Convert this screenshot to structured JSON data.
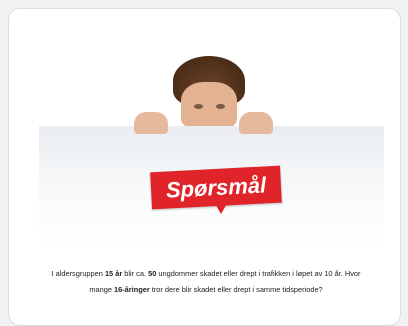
{
  "image_label": "Spørsmål",
  "question": {
    "p1": "I aldersgruppen ",
    "b1": "15 år",
    "p2": " blir ca. ",
    "b2": "50",
    "p3": " ungdommer skadet eller drept i trafikken i løpet av 10 år. Hvor mange ",
    "b3": "16-åringer",
    "p4": " tror dere blir skadet eller drept i samme tidsperiode?"
  },
  "colors": {
    "accent": "#e0242a",
    "card": "#ffffff",
    "background": "#f1f2f4"
  }
}
